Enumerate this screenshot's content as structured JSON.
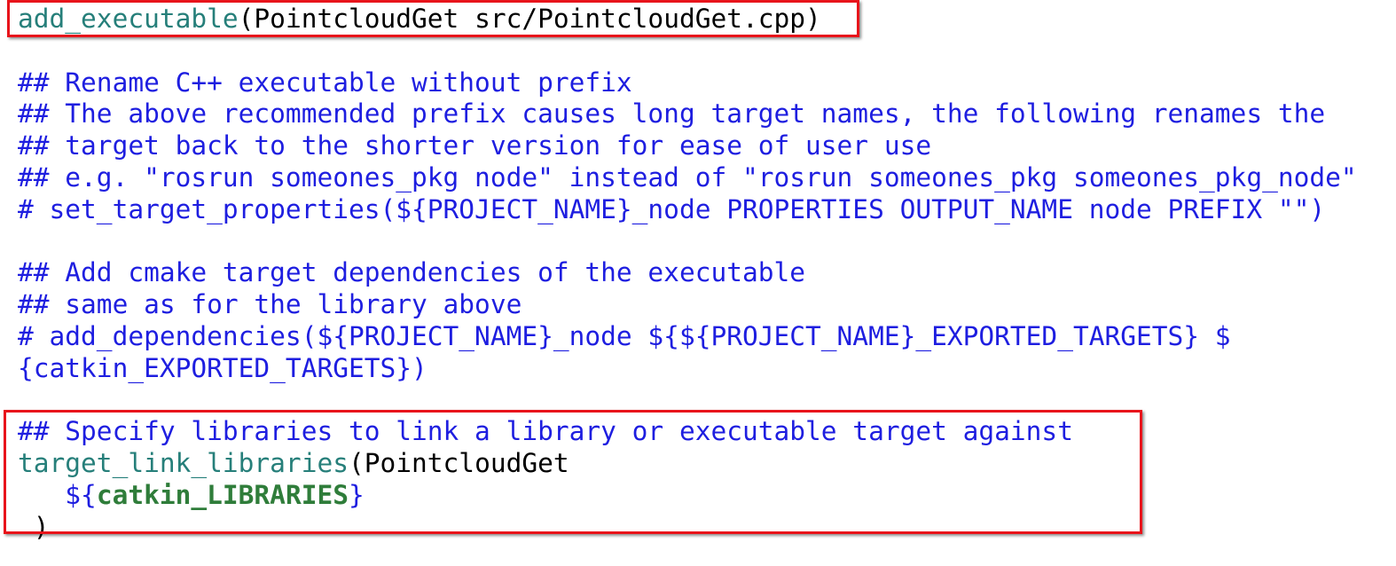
{
  "code_lines": [
    {
      "parts": [
        {
          "text": "add_executable",
          "kind": "fn"
        },
        {
          "text": "(PointcloudGet src/PointcloudGet.cpp)",
          "kind": "tx"
        }
      ]
    },
    {
      "parts": []
    },
    {
      "parts": [
        {
          "text": "## Rename C++ executable without prefix",
          "kind": "cm"
        }
      ]
    },
    {
      "parts": [
        {
          "text": "## The above recommended prefix causes long target names, the following renames the",
          "kind": "cm"
        }
      ]
    },
    {
      "parts": [
        {
          "text": "## target back to the shorter version for ease of user use",
          "kind": "cm"
        }
      ]
    },
    {
      "parts": [
        {
          "text": "## e.g. \"rosrun someones_pkg node\" instead of \"rosrun someones_pkg someones_pkg_node\"",
          "kind": "cm"
        }
      ]
    },
    {
      "parts": [
        {
          "text": "# set_target_properties(${PROJECT_NAME}_node PROPERTIES OUTPUT_NAME node PREFIX \"\")",
          "kind": "cm"
        }
      ]
    },
    {
      "parts": []
    },
    {
      "parts": [
        {
          "text": "## Add cmake target dependencies of the executable",
          "kind": "cm"
        }
      ]
    },
    {
      "parts": [
        {
          "text": "## same as for the library above",
          "kind": "cm"
        }
      ]
    },
    {
      "parts": [
        {
          "text": "# add_dependencies(${PROJECT_NAME}_node ${${PROJECT_NAME}_EXPORTED_TARGETS} $",
          "kind": "cm"
        }
      ]
    },
    {
      "parts": [
        {
          "text": "{catkin_EXPORTED_TARGETS})",
          "kind": "cm"
        }
      ]
    },
    {
      "parts": []
    },
    {
      "parts": [
        {
          "text": "## Specify libraries to link a library or executable target against",
          "kind": "cm"
        }
      ]
    },
    {
      "parts": [
        {
          "text": "target_link_libraries",
          "kind": "fn"
        },
        {
          "text": "(PointcloudGet",
          "kind": "tx"
        }
      ]
    },
    {
      "parts": [
        {
          "text": "   ${",
          "kind": "br"
        },
        {
          "text": "catkin_LIBRARIES",
          "kind": "var"
        },
        {
          "text": "}",
          "kind": "br"
        }
      ]
    },
    {
      "parts": [
        {
          "text": " )",
          "kind": "tx"
        }
      ]
    }
  ],
  "colors": {
    "function": "#267f7a",
    "comment": "#1e1ee0",
    "text": "#000000",
    "variable": "#2f7d3a",
    "highlight": "#e8141b"
  }
}
